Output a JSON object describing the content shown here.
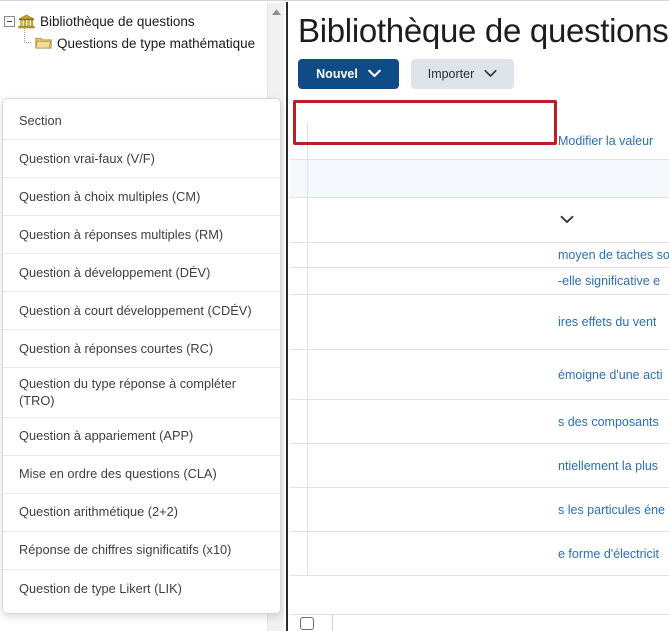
{
  "sidebar": {
    "items": [
      {
        "label": "Bibliothèque de questions",
        "icon": "bank-icon",
        "level": 0,
        "expanded": true
      },
      {
        "label": "Questions de type mathématique",
        "icon": "folder-icon",
        "level": 1,
        "expanded": false
      }
    ],
    "scrollbar": {
      "up_arrow": "scroll-up-arrow"
    }
  },
  "header": {
    "title": "Bibliothèque de questions"
  },
  "toolbar": {
    "new_label": "Nouvel",
    "new_chevron": "chevron-down-icon",
    "import_label": "Importer",
    "import_chevron": "chevron-down-icon"
  },
  "dropdown": {
    "open": true,
    "highlighted_index": 0,
    "highlight_color": "#bb1f25",
    "items": [
      {
        "label": "Section"
      },
      {
        "label": "Question vrai-faux (V/F)"
      },
      {
        "label": "Question à choix multiples (CM)"
      },
      {
        "label": "Question à réponses multiples (RM)"
      },
      {
        "label": "Question à développement (DÉV)"
      },
      {
        "label": "Question à court développement (CDÉV)"
      },
      {
        "label": "Question à réponses courtes (RC)"
      },
      {
        "label": "Question du type réponse à compléter (TRO)"
      },
      {
        "label": "Question à appariement (APP)"
      },
      {
        "label": "Mise en ordre des questions (CLA)"
      },
      {
        "label": "Question arithmétique (2+2)"
      },
      {
        "label": "Réponse de chiffres significatifs (x10)"
      },
      {
        "label": "Question de type Likert (LIK)"
      }
    ]
  },
  "background_table": {
    "rows": [
      {
        "text": "Modifier la valeur",
        "type": "link",
        "height": 38,
        "shaded": false
      },
      {
        "text": "",
        "type": "blank",
        "height": 38,
        "shaded": true
      },
      {
        "text": "",
        "type": "chevron",
        "height": 45,
        "shaded": false
      },
      {
        "text": "moyen de taches so",
        "type": "link",
        "height": 25,
        "shaded": false
      },
      {
        "text": "-elle significative e",
        "type": "link",
        "height": 27,
        "shaded": false
      },
      {
        "text": "ires effets du vent",
        "type": "link",
        "height": 55,
        "shaded": false
      },
      {
        "text": "émoigne d'une acti",
        "type": "link",
        "height": 50,
        "shaded": false
      },
      {
        "text": "s des composants",
        "type": "link",
        "height": 44,
        "shaded": false
      },
      {
        "text": "ntiellement la plus",
        "type": "link",
        "height": 44,
        "shaded": false
      },
      {
        "text": "s les particules éne",
        "type": "link",
        "height": 44,
        "shaded": false
      },
      {
        "text": "e forme d'électricit",
        "type": "link",
        "height": 44,
        "shaded": false
      }
    ],
    "bottom_row": {
      "checkbox": "row-select-checkbox",
      "text": ""
    }
  },
  "colors": {
    "primary_button": "#0f4b86",
    "secondary_button": "#dfe4ea",
    "link": "#2a6fb8",
    "highlight": "#bb1f25"
  }
}
